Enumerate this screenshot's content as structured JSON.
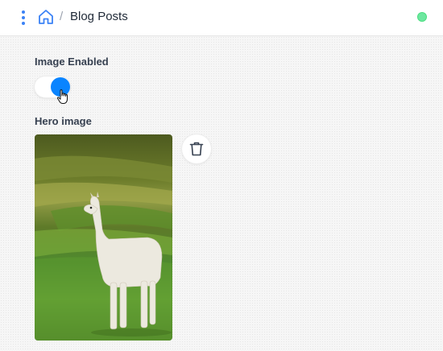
{
  "header": {
    "breadcrumb_separator": "/",
    "breadcrumb_current": "Blog Posts",
    "status_color": "#6ee7a0"
  },
  "form": {
    "image_enabled_label": "Image Enabled",
    "image_enabled_value": true,
    "hero_image_label": "Hero image"
  },
  "icons": {
    "menu": "vertical-dots-icon",
    "home": "home-icon",
    "delete": "trash-icon",
    "cursor": "hand-pointer-icon"
  },
  "colors": {
    "accent": "#3b82f6",
    "toggle_on": "#0a84ff"
  }
}
